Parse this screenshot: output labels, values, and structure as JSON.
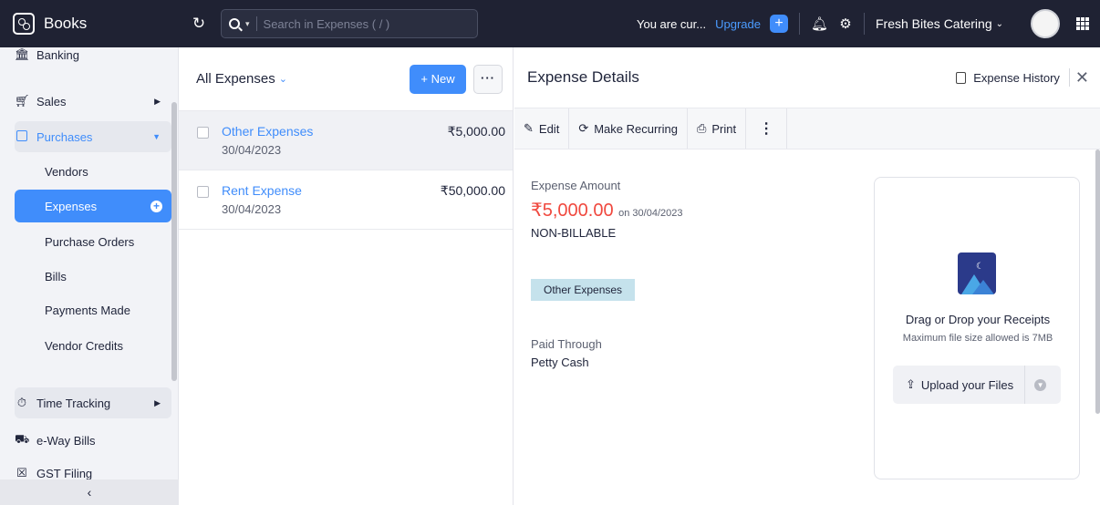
{
  "topbar": {
    "brand": "Books",
    "search_placeholder": "Search in Expenses ( / )",
    "trial_text": "You are cur...",
    "upgrade": "Upgrade",
    "org_name": "Fresh Bites Catering"
  },
  "sidebar": {
    "banking": "Banking",
    "sales": "Sales",
    "purchases": "Purchases",
    "sub_items": [
      "Vendors",
      "Expenses",
      "Purchase Orders",
      "Bills",
      "Payments Made",
      "Vendor Credits"
    ],
    "time_tracking": "Time Tracking",
    "eway_bills": "e-Way Bills",
    "gst_filing": "GST Filing"
  },
  "list": {
    "title": "All Expenses",
    "new_label": "+ New",
    "more_label": "···",
    "rows": [
      {
        "name": "Other Expenses",
        "date": "30/04/2023",
        "amount": "₹5,000.00"
      },
      {
        "name": "Rent Expense",
        "date": "30/04/2023",
        "amount": "₹50,000.00"
      }
    ]
  },
  "detail": {
    "title": "Expense Details",
    "history": "Expense History",
    "toolbar": {
      "edit": "Edit",
      "recurring": "Make Recurring",
      "print": "Print"
    },
    "amount_label": "Expense Amount",
    "amount": "₹5,000.00",
    "on_date": "on 30/04/2023",
    "billable": "NON-BILLABLE",
    "category_tag": "Other Expenses",
    "paid_label": "Paid Through",
    "paid_value": "Petty Cash",
    "dropzone": {
      "title": "Drag or Drop your Receipts",
      "subtitle": "Maximum file size allowed is 7MB",
      "upload": "Upload your Files"
    }
  },
  "colors": {
    "accent": "#408dfb",
    "topbar": "#1f2233",
    "amount": "#f0483e",
    "tag": "#c5e2ec"
  }
}
